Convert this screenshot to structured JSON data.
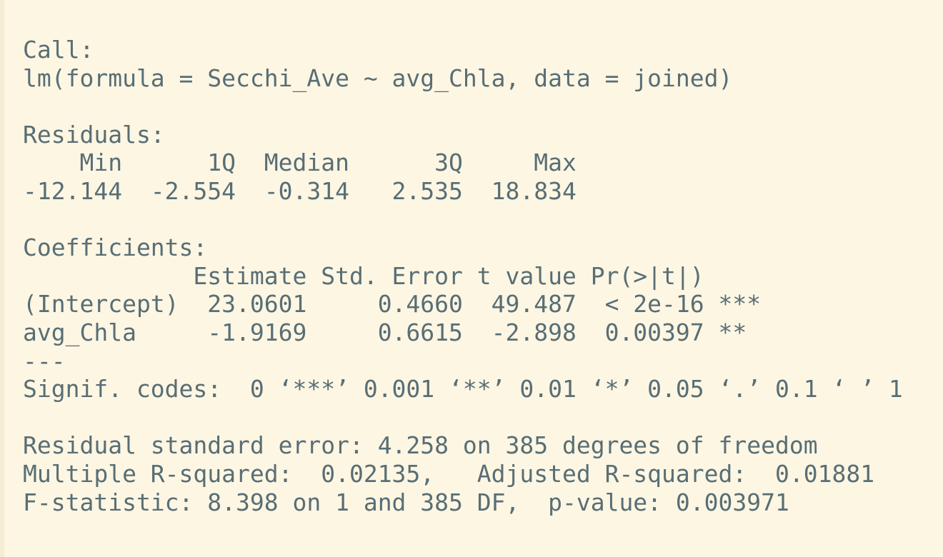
{
  "output": {
    "lines": [
      "Call:",
      "lm(formula = Secchi_Ave ~ avg_Chla, data = joined)",
      "",
      "Residuals:",
      "    Min      1Q  Median      3Q     Max ",
      "-12.144  -2.554  -0.314   2.535  18.834 ",
      "",
      "Coefficients:",
      "            Estimate Std. Error t value Pr(>|t|)    ",
      "(Intercept)  23.0601     0.4660  49.487  < 2e-16 ***",
      "avg_Chla     -1.9169     0.6615  -2.898  0.00397 ** ",
      "---",
      "Signif. codes:  0 ‘***’ 0.001 ‘**’ 0.01 ‘*’ 0.05 ‘.’ 0.1 ‘ ’ 1",
      "",
      "Residual standard error: 4.258 on 385 degrees of freedom",
      "Multiple R-squared:  0.02135,\tAdjusted R-squared:  0.01881 ",
      "F-statistic: 8.398 on 1 and 385 DF,  p-value: 0.003971"
    ]
  },
  "colors": {
    "background": "#fdf6e3",
    "text": "#586e75"
  }
}
